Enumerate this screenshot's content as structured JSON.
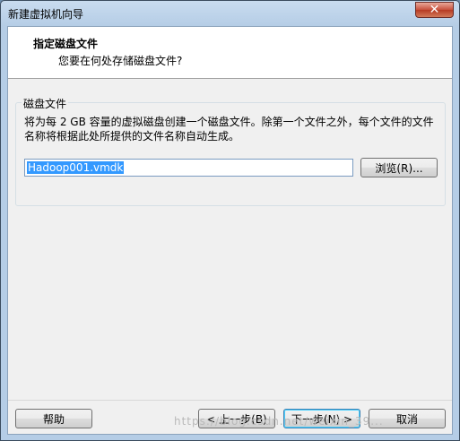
{
  "window": {
    "title": "新建虚拟机向导",
    "close_glyph": "✕"
  },
  "header": {
    "title": "指定磁盘文件",
    "subtitle": "您要在何处存储磁盘文件?"
  },
  "disk_file": {
    "group_label": "磁盘文件",
    "description": "将为每 2 GB 容量的虚拟磁盘创建一个磁盘文件。除第一个文件之外，每个文件的文件名称将根据此处所提供的文件名称自动生成。",
    "filename": "Hadoop001.vmdk",
    "browse_label": "浏览(R)..."
  },
  "footer": {
    "help_label": "帮助",
    "back_label": "< 上一步(B)",
    "next_label": "下一步(N) >",
    "cancel_label": "取消"
  },
  "watermark": "https://blog.csdn.net/weixin_39..."
}
